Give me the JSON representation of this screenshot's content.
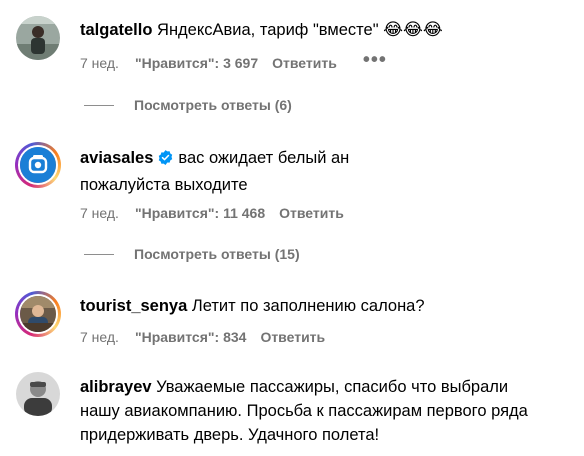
{
  "comments": [
    {
      "username": "talgatello",
      "text": "ЯндексАвиа, тариф \"вместе\"",
      "emoji": "😂😂😂",
      "time": "7 нед.",
      "likes": "\"Нравится\": 3 697",
      "reply": "Ответить",
      "more": "•••",
      "view_replies": "Посмотреть ответы (6)"
    },
    {
      "username": "aviasales",
      "text_line1": "вас ожидает белый ан",
      "text_line2": "пожалуйста выходите",
      "time": "7 нед.",
      "likes": "\"Нравится\": 11 468",
      "reply": "Ответить",
      "view_replies": "Посмотреть ответы (15)"
    },
    {
      "username": "tourist_senya",
      "text": "Летит по заполнению салона?",
      "time": "7 нед.",
      "likes": "\"Нравится\": 834",
      "reply": "Ответить"
    },
    {
      "username": "alibrayev",
      "text_line1": "Уважаемые пассажиры, спасибо что выбрали",
      "text_line2": "нашу авиакомпанию. Просьба к пассажирам первого ряда",
      "text_line3": "придерживать дверь. Удачного полета!"
    }
  ],
  "colors": {
    "meta_gray": "#737373",
    "verified_blue": "#0095f6",
    "aviasales_blue": "#1a7fd6"
  }
}
